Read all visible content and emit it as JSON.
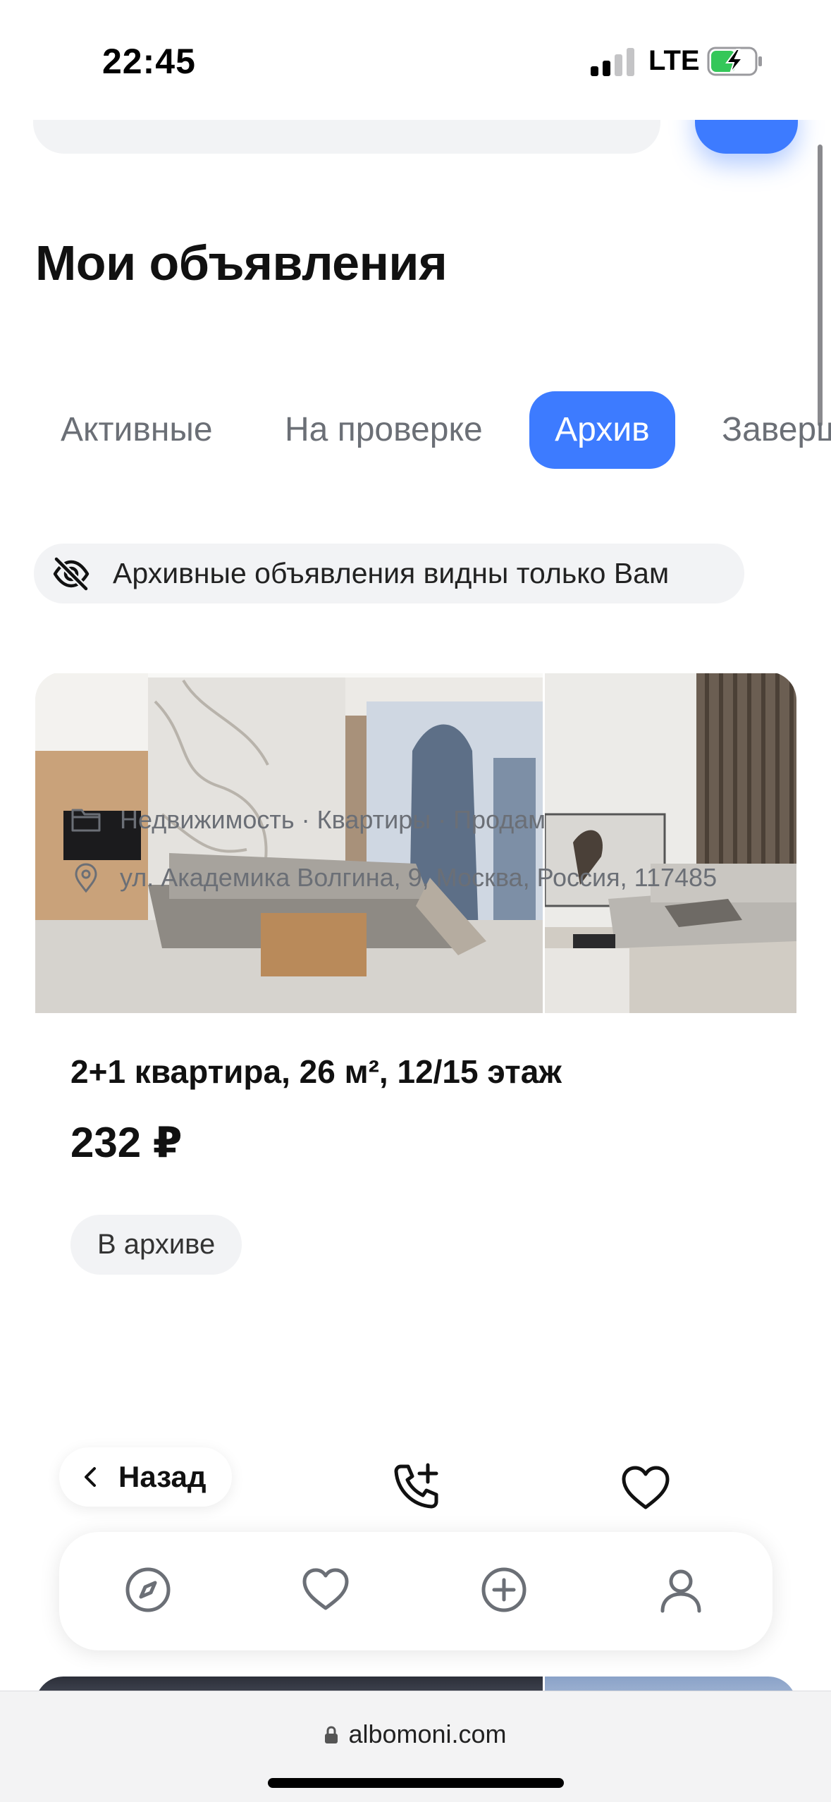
{
  "status_bar": {
    "time": "22:45",
    "network": "LTE"
  },
  "header": {
    "title": "Мои объявления"
  },
  "tabs": [
    {
      "label": "Активные",
      "active": false
    },
    {
      "label": "На проверке",
      "active": false
    },
    {
      "label": "Архив",
      "active": true
    },
    {
      "label": "Заверш",
      "active": false
    }
  ],
  "notice": {
    "text": "Архивные объявления видны только Вам",
    "icon": "eye-off-icon"
  },
  "listing": {
    "title": "2+1 квартира, 26 м², 12/15 этаж",
    "price": "232 ₽",
    "status": "В архиве",
    "category": "Недвижимость · Квартиры · Продам",
    "address": "ул. Академика Волгина, 9, Москва, Россия, 117485"
  },
  "actions": {
    "back_label": "Назад",
    "call_icon": "phone-add-icon",
    "favorite_icon": "heart-icon"
  },
  "tabbar": [
    {
      "name": "explore",
      "icon": "compass-icon"
    },
    {
      "name": "favorites",
      "icon": "heart-icon"
    },
    {
      "name": "add",
      "icon": "plus-circle-icon"
    },
    {
      "name": "profile",
      "icon": "user-icon"
    }
  ],
  "browser": {
    "url": "albomoni.com"
  },
  "colors": {
    "accent": "#3d7bff",
    "chip_bg": "#f2f3f5",
    "muted": "#6b6f76"
  }
}
